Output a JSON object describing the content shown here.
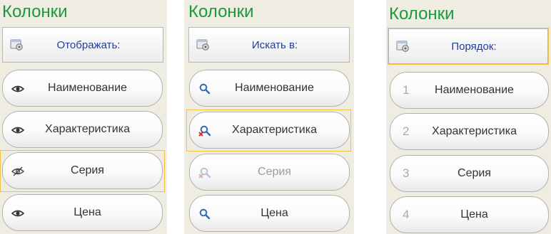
{
  "panels": [
    {
      "title": "Колонки",
      "header_label": "Отображать:",
      "items": [
        {
          "label": "Наименование",
          "icon": "eye-icon"
        },
        {
          "label": "Характеристика",
          "icon": "eye-icon"
        },
        {
          "label": "Серия",
          "icon": "eye-hidden-icon"
        },
        {
          "label": "Цена",
          "icon": "eye-icon"
        }
      ]
    },
    {
      "title": "Колонки",
      "header_label": "Искать в:",
      "items": [
        {
          "label": "Наименование",
          "icon": "search-icon"
        },
        {
          "label": "Характеристика",
          "icon": "search-remove-icon"
        },
        {
          "label": "Серия",
          "icon": "search-disabled-icon"
        },
        {
          "label": "Цена",
          "icon": "search-icon"
        }
      ]
    },
    {
      "title": "Колонки",
      "header_label": "Порядок:",
      "items": [
        {
          "label": "Наименование",
          "number": "1"
        },
        {
          "label": "Характеристика",
          "number": "2"
        },
        {
          "label": "Серия",
          "number": "3"
        },
        {
          "label": "Цена",
          "number": "4"
        }
      ]
    }
  ],
  "colors": {
    "title": "#1a9a3c",
    "header_label": "#1f3c9e",
    "panel_background": "#efece1",
    "focus_frame": "#f3c243",
    "search_icon": "#2f6db5",
    "remove_mark": "#d03030"
  }
}
